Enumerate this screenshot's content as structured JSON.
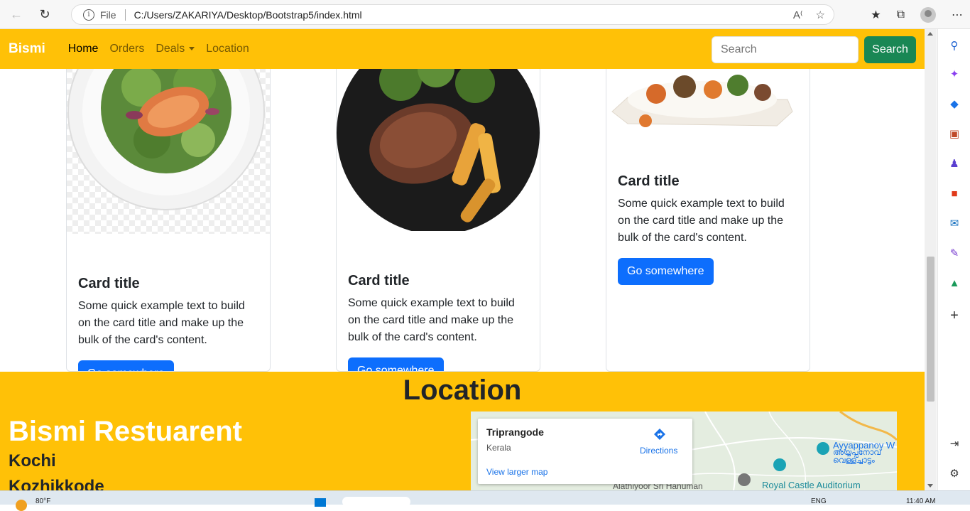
{
  "browser": {
    "file_label": "File",
    "url": "C:/Users/ZAKARIYA/Desktop/Bootstrap5/index.html"
  },
  "navbar": {
    "brand": "Bismi",
    "links": [
      "Home",
      "Orders",
      "Deals",
      "Location"
    ],
    "search_placeholder": "Search",
    "search_button": "Search"
  },
  "cards": [
    {
      "title": "Card title",
      "text": "Some quick example text to build on the card title and make up the bulk of the card's content.",
      "button": "Go somewhere"
    },
    {
      "title": "Card title",
      "text": "Some quick example text to build on the card title and make up the bulk of the card's content.",
      "button": "Go somewhere"
    },
    {
      "title": "Card title",
      "text": "Some quick example text to build on the card title and make up the bulk of the card's content.",
      "button": "Go somewhere"
    }
  ],
  "location": {
    "heading": "Location",
    "restaurant": "Bismi Restuarent",
    "cities": [
      "Kochi",
      "Kozhikkode"
    ],
    "map": {
      "place": "Triprangode",
      "region": "Kerala",
      "directions": "Directions",
      "larger_map": "View larger map",
      "labels": [
        "Ayyappanov W",
        "അയ്യപ്പനോവ്",
        "വെള്ളച്ചാട്ടം",
        "Alathiyoor Sri Hanuman",
        "Royal Castle Auditorium"
      ]
    }
  },
  "taskbar": {
    "weather": "80°F",
    "lang": "ENG",
    "time": "11:40 AM"
  },
  "colors": {
    "navbar": "#ffc107",
    "primary": "#0d6efd",
    "success": "#198754"
  }
}
